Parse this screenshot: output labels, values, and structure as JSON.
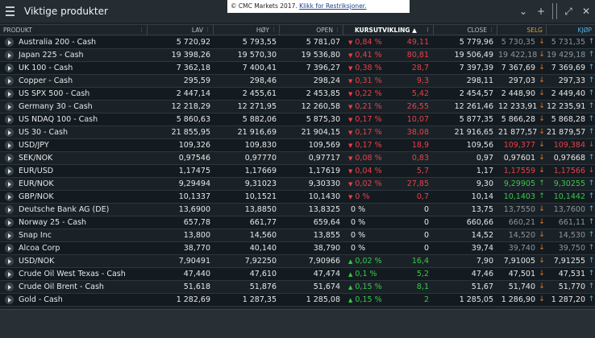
{
  "window": {
    "title": "Viktige produkter",
    "notice_text": "© CMC Markets 2017.",
    "notice_link": "Klikk for Restriksjoner."
  },
  "columns": {
    "product": "PRODUKT",
    "low": "LAV",
    "high": "HØY",
    "open": "OPEN",
    "change": "KURSUTVIKLING ▲",
    "close": "CLOSE",
    "sell": "SELG",
    "buy": "KJØP"
  },
  "colors": {
    "up": "#36c94a",
    "down": "#e8404a",
    "sell_header": "#e0a32a",
    "buy_header": "#4fb3e6"
  },
  "rows": [
    {
      "name": "Australia 200 - Cash",
      "low": "5 720,92",
      "high": "5 793,55",
      "open": "5 781,07",
      "pct": "0,84 %",
      "chg": "49,11",
      "dir": "down",
      "close": "5 779,96",
      "sell": "5 730,35",
      "buy": "5 731,35",
      "sell_dir": "down",
      "buy_dir": "up",
      "sell_color": "grey",
      "buy_color": "grey"
    },
    {
      "name": "Japan 225 - Cash",
      "low": "19 398,26",
      "high": "19 570,30",
      "open": "19 536,80",
      "pct": "0,41 %",
      "chg": "80,81",
      "dir": "down",
      "close": "19 506,49",
      "sell": "19 422,18",
      "buy": "19 429,18",
      "sell_dir": "down",
      "buy_dir": "up",
      "sell_color": "grey",
      "buy_color": "grey"
    },
    {
      "name": "UK 100 - Cash",
      "low": "7 362,18",
      "high": "7 400,41",
      "open": "7 396,27",
      "pct": "0,38 %",
      "chg": "28,7",
      "dir": "down",
      "close": "7 397,39",
      "sell": "7 367,69",
      "buy": "7 369,69",
      "sell_dir": "down",
      "buy_dir": "up",
      "sell_color": "neutral",
      "buy_color": "neutral"
    },
    {
      "name": "Copper - Cash",
      "low": "295,59",
      "high": "298,46",
      "open": "298,24",
      "pct": "0,31 %",
      "chg": "9,3",
      "dir": "down",
      "close": "298,11",
      "sell": "297,03",
      "buy": "297,33",
      "sell_dir": "down",
      "buy_dir": "up",
      "sell_color": "neutral",
      "buy_color": "neutral"
    },
    {
      "name": "US SPX 500 - Cash",
      "low": "2 447,14",
      "high": "2 455,61",
      "open": "2 453,85",
      "pct": "0,22 %",
      "chg": "5,42",
      "dir": "down",
      "close": "2 454,57",
      "sell": "2 448,90",
      "buy": "2 449,40",
      "sell_dir": "down",
      "buy_dir": "up",
      "sell_color": "neutral",
      "buy_color": "neutral"
    },
    {
      "name": "Germany 30 - Cash",
      "low": "12 218,29",
      "high": "12 271,95",
      "open": "12 260,58",
      "pct": "0,21 %",
      "chg": "26,55",
      "dir": "down",
      "close": "12 261,46",
      "sell": "12 233,91",
      "buy": "12 235,91",
      "sell_dir": "down",
      "buy_dir": "up",
      "sell_color": "neutral",
      "buy_color": "neutral"
    },
    {
      "name": "US NDAQ 100 - Cash",
      "low": "5 860,63",
      "high": "5 882,06",
      "open": "5 875,30",
      "pct": "0,17 %",
      "chg": "10,07",
      "dir": "down",
      "close": "5 877,35",
      "sell": "5 866,28",
      "buy": "5 868,28",
      "sell_dir": "down",
      "buy_dir": "up",
      "sell_color": "neutral",
      "buy_color": "neutral"
    },
    {
      "name": "US 30 - Cash",
      "low": "21 855,95",
      "high": "21 916,69",
      "open": "21 904,15",
      "pct": "0,17 %",
      "chg": "38,08",
      "dir": "down",
      "close": "21 916,65",
      "sell": "21 877,57",
      "buy": "21 879,57",
      "sell_dir": "down",
      "buy_dir": "up",
      "sell_color": "neutral",
      "buy_color": "neutral"
    },
    {
      "name": "USD/JPY",
      "low": "109,326",
      "high": "109,830",
      "open": "109,569",
      "pct": "0,17 %",
      "chg": "18,9",
      "dir": "down",
      "close": "109,56",
      "sell": "109,377",
      "buy": "109,384",
      "sell_dir": "down",
      "buy_dir": "down",
      "sell_color": "down",
      "buy_color": "down"
    },
    {
      "name": "SEK/NOK",
      "low": "0,97546",
      "high": "0,97770",
      "open": "0,97717",
      "pct": "0,08 %",
      "chg": "0,83",
      "dir": "down",
      "close": "0,97",
      "sell": "0,97601",
      "buy": "0,97668",
      "sell_dir": "down",
      "buy_dir": "up",
      "sell_color": "neutral",
      "buy_color": "neutral"
    },
    {
      "name": "EUR/USD",
      "low": "1,17475",
      "high": "1,17669",
      "open": "1,17619",
      "pct": "0,04 %",
      "chg": "5,7",
      "dir": "down",
      "close": "1,17",
      "sell": "1,17559",
      "buy": "1,17566",
      "sell_dir": "down",
      "buy_dir": "down",
      "sell_color": "down",
      "buy_color": "down"
    },
    {
      "name": "EUR/NOK",
      "low": "9,29494",
      "high": "9,31023",
      "open": "9,30330",
      "pct": "0,02 %",
      "chg": "27,85",
      "dir": "down",
      "close": "9,30",
      "sell": "9,29905",
      "buy": "9,30255",
      "sell_dir": "up",
      "buy_dir": "up",
      "sell_color": "up",
      "buy_color": "up"
    },
    {
      "name": "GBP/NOK",
      "low": "10,1337",
      "high": "10,1521",
      "open": "10,1430",
      "pct": "0 %",
      "chg": "0,7",
      "dir": "down",
      "close": "10,14",
      "sell": "10,1403",
      "buy": "10,1442",
      "sell_dir": "up",
      "buy_dir": "up",
      "sell_color": "up",
      "buy_color": "up"
    },
    {
      "name": "Deutsche Bank AG (DE)",
      "low": "13,6900",
      "high": "13,8850",
      "open": "13,8325",
      "pct": "0 %",
      "chg": "0",
      "dir": "flat",
      "close": "13,75",
      "sell": "13,7550",
      "buy": "13,7600",
      "sell_dir": "down",
      "buy_dir": "up",
      "sell_color": "grey",
      "buy_color": "grey"
    },
    {
      "name": "Norway 25 - Cash",
      "low": "657,78",
      "high": "661,77",
      "open": "659,64",
      "pct": "0 %",
      "chg": "0",
      "dir": "flat",
      "close": "660,66",
      "sell": "660,21",
      "buy": "661,11",
      "sell_dir": "down",
      "buy_dir": "up",
      "sell_color": "grey",
      "buy_color": "grey"
    },
    {
      "name": "Snap Inc",
      "low": "13,800",
      "high": "14,560",
      "open": "13,855",
      "pct": "0 %",
      "chg": "0",
      "dir": "flat",
      "close": "14,52",
      "sell": "14,520",
      "buy": "14,530",
      "sell_dir": "down",
      "buy_dir": "up",
      "sell_color": "grey",
      "buy_color": "grey"
    },
    {
      "name": "Alcoa Corp",
      "low": "38,770",
      "high": "40,140",
      "open": "38,790",
      "pct": "0 %",
      "chg": "0",
      "dir": "flat",
      "close": "39,74",
      "sell": "39,740",
      "buy": "39,750",
      "sell_dir": "down",
      "buy_dir": "up",
      "sell_color": "grey",
      "buy_color": "grey"
    },
    {
      "name": "USD/NOK",
      "low": "7,90491",
      "high": "7,92250",
      "open": "7,90966",
      "pct": "0,02 %",
      "chg": "16,4",
      "dir": "up",
      "close": "7,90",
      "sell": "7,91005",
      "buy": "7,91255",
      "sell_dir": "down",
      "buy_dir": "up",
      "sell_color": "neutral",
      "buy_color": "neutral"
    },
    {
      "name": "Crude Oil West Texas - Cash",
      "low": "47,440",
      "high": "47,610",
      "open": "47,474",
      "pct": "0,1 %",
      "chg": "5,2",
      "dir": "up",
      "close": "47,46",
      "sell": "47,501",
      "buy": "47,531",
      "sell_dir": "down",
      "buy_dir": "up",
      "sell_color": "neutral",
      "buy_color": "neutral"
    },
    {
      "name": "Crude Oil Brent - Cash",
      "low": "51,618",
      "high": "51,876",
      "open": "51,674",
      "pct": "0,15 %",
      "chg": "8,1",
      "dir": "up",
      "close": "51,67",
      "sell": "51,740",
      "buy": "51,770",
      "sell_dir": "down",
      "buy_dir": "up",
      "sell_color": "neutral",
      "buy_color": "neutral"
    },
    {
      "name": "Gold - Cash",
      "low": "1 282,69",
      "high": "1 287,35",
      "open": "1 285,08",
      "pct": "0,15 %",
      "chg": "2",
      "dir": "up",
      "close": "1 285,05",
      "sell": "1 286,90",
      "buy": "1 287,20",
      "sell_dir": "down",
      "buy_dir": "up",
      "sell_color": "neutral",
      "buy_color": "neutral"
    }
  ]
}
